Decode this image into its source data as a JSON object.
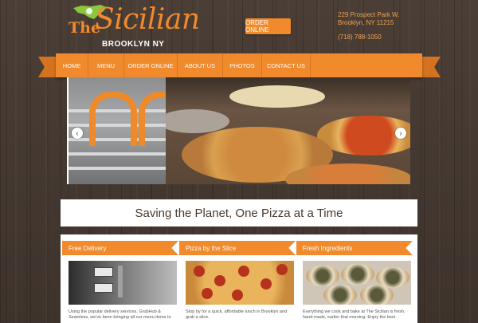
{
  "header": {
    "logo_the": "The",
    "logo_name": "Sicilian",
    "logo_city": "BROOKLYN NY",
    "order_button": "ORDER ONLINE",
    "address_line1": "229 Prospect Park W.",
    "address_line2": "Brooklyn, NY 11215",
    "phone": "(718) 788-1050"
  },
  "nav": {
    "items": [
      "HOME",
      "MENU",
      "ORDER ONLINE",
      "ABOUT US",
      "PHOTOS",
      "CONTACT US"
    ]
  },
  "slider": {
    "prev_arrow": "‹",
    "next_arrow": "›"
  },
  "tagline": "Saving the Planet, One Pizza at a Time",
  "cards": [
    {
      "title": "Free Delivery",
      "text": "Using the popular delivery services, GrubHub & Seamless, we've been bringing all our menu items to"
    },
    {
      "title": "Pizza by the Slice",
      "text": "Stop by for a quick, affordable lunch in Brooklyn and grab a slice."
    },
    {
      "title": "Fresh Ingredients",
      "text": "Everything we cook and bake at The Sicilian is fresh, hand-made, earlier that morning. Enjoy the best"
    }
  ],
  "colors": {
    "accent": "#f08a2c",
    "wood": "#453a32"
  }
}
